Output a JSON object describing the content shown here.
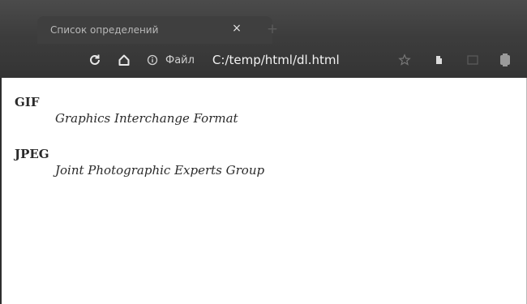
{
  "browser": {
    "tab_title": "Список определений",
    "tab_close": "×",
    "new_tab": "+",
    "address_scheme": "Файл",
    "address_url": "C:/temp/html/dl.html"
  },
  "icons": {
    "reload": "reload-icon",
    "home": "home-icon",
    "info": "info-icon",
    "bookmark": "star-icon",
    "extension": "extension-icon",
    "reading_list": "reading-list-icon",
    "profile": "profile-icon"
  },
  "definitions": [
    {
      "term": "GIF",
      "description": "Graphics Interchange Format"
    },
    {
      "term": "JPEG",
      "description": "Joint Photographic Experts Group"
    }
  ]
}
